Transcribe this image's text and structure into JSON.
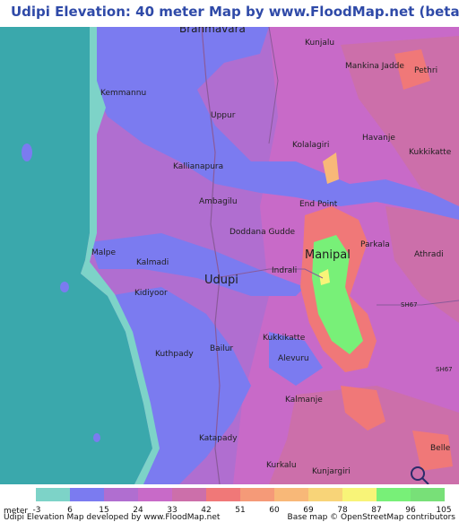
{
  "title": "Udipi Elevation: 40 meter Map by www.FloodMap.net (beta)",
  "places": {
    "brahmavara": "Brahmavara",
    "kunjalu": "Kunjalu",
    "mankina_jadde": "Mankina Jadde",
    "pethri": "Pethri",
    "kemmannu": "Kemmannu",
    "uppur": "Uppur",
    "havanje": "Havanje",
    "kolalagiri": "Kolalagiri",
    "kukkikatte_ne": "Kukkikatte",
    "kallianapura": "Kallianapura",
    "ambagilu": "Ambagilu",
    "end_point": "End Point",
    "doddana_gudde": "Doddana Gudde",
    "parkala": "Parkala",
    "manipal": "Manipal",
    "athradi": "Athradi",
    "malpe": "Malpe",
    "kalmadi": "Kalmadi",
    "indrali": "Indrali",
    "udupi": "Udupi",
    "kidiyoor": "Kidiyoor",
    "sh67_a": "SH67",
    "kukkikatte": "Kukkikatte",
    "bailur": "Bailur",
    "alevuru": "Alevuru",
    "kuthpady": "Kuthpady",
    "sh67_b": "SH67",
    "kalmanje": "Kalmanje",
    "katapady": "Katapady",
    "belle": "Belle",
    "kurkalu": "Kurkalu",
    "kunjargiri": "Kunjargiri"
  },
  "legend": {
    "unit": "meter",
    "ticks": [
      "-3",
      "6",
      "15",
      "24",
      "33",
      "42",
      "51",
      "60",
      "69",
      "78",
      "87",
      "96",
      "105"
    ],
    "colors": [
      "#7dd3c8",
      "#7b7bf0",
      "#b06ed0",
      "#c86ac8",
      "#cc6faa",
      "#f07878",
      "#f59a78",
      "#f8b878",
      "#f8d478",
      "#f8f478",
      "#78f078",
      "#78e078"
    ]
  },
  "colors": {
    "sea": "#3aa8ac",
    "coast": "#7dd3c8",
    "low": "#7b7bf0",
    "mid": "#b06ed0",
    "midhigh": "#c86ac8",
    "high": "#cc6faa",
    "peak": "#f07878",
    "green": "#78f078",
    "yellow": "#f8f478"
  },
  "footer": {
    "left": "Udipi Elevation Map developed by www.FloodMap.net",
    "right": "Base map © OpenStreetMap contributors"
  }
}
